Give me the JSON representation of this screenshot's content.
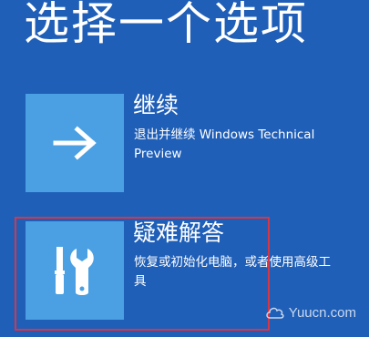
{
  "screen": {
    "title": "选择一个选项"
  },
  "options": [
    {
      "title": "继续",
      "description": "退出并继续 Windows Technical Preview",
      "icon": "arrow-right-icon"
    },
    {
      "title": "疑难解答",
      "description": "恢复或初始化电脑，或者使用高级工具",
      "icon": "tools-icon",
      "highlighted": true
    }
  ],
  "colors": {
    "background": "#1f5fb8",
    "tile": "#4aa0e2",
    "highlight_border": "#d83545",
    "text": "#ffffff"
  },
  "watermark": {
    "text": "Yuucn.com"
  }
}
